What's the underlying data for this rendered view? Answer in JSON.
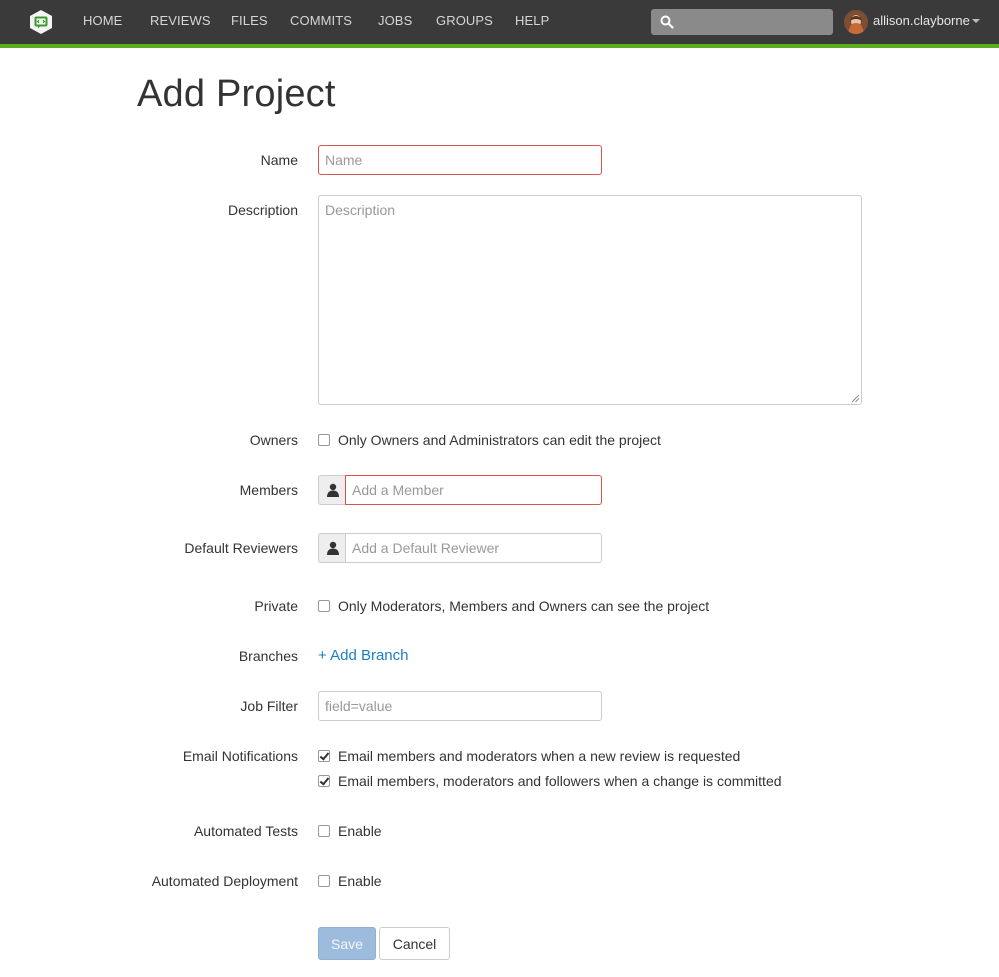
{
  "nav": {
    "links": [
      "HOME",
      "REVIEWS",
      "FILES",
      "COMMITS",
      "JOBS",
      "GROUPS",
      "HELP"
    ],
    "search_placeholder": "",
    "username": "allison.clayborne"
  },
  "page": {
    "title": "Add Project"
  },
  "form": {
    "name": {
      "label": "Name",
      "placeholder": "Name"
    },
    "description": {
      "label": "Description",
      "placeholder": "Description"
    },
    "owners": {
      "label": "Owners",
      "checkbox_label": "Only Owners and Administrators can edit the project",
      "checked": false
    },
    "members": {
      "label": "Members",
      "placeholder": "Add a Member"
    },
    "default_reviewers": {
      "label": "Default Reviewers",
      "placeholder": "Add a Default Reviewer"
    },
    "private": {
      "label": "Private",
      "checkbox_label": "Only Moderators, Members and Owners can see the project",
      "checked": false
    },
    "branches": {
      "label": "Branches",
      "add_link": "+ Add Branch"
    },
    "job_filter": {
      "label": "Job Filter",
      "placeholder": "field=value"
    },
    "email_notifications": {
      "label": "Email Notifications",
      "options": [
        {
          "label": "Email members and moderators when a new review is requested",
          "checked": true
        },
        {
          "label": "Email members, moderators and followers when a change is committed",
          "checked": true
        }
      ]
    },
    "automated_tests": {
      "label": "Automated Tests",
      "checkbox_label": "Enable",
      "checked": false
    },
    "automated_deployment": {
      "label": "Automated Deployment",
      "checkbox_label": "Enable",
      "checked": false
    }
  },
  "buttons": {
    "save": "Save",
    "cancel": "Cancel"
  },
  "colors": {
    "navbar": "#3a3a3a",
    "accent": "#5bad1f",
    "link": "#1c7ec2",
    "error_border": "#d9534f"
  }
}
